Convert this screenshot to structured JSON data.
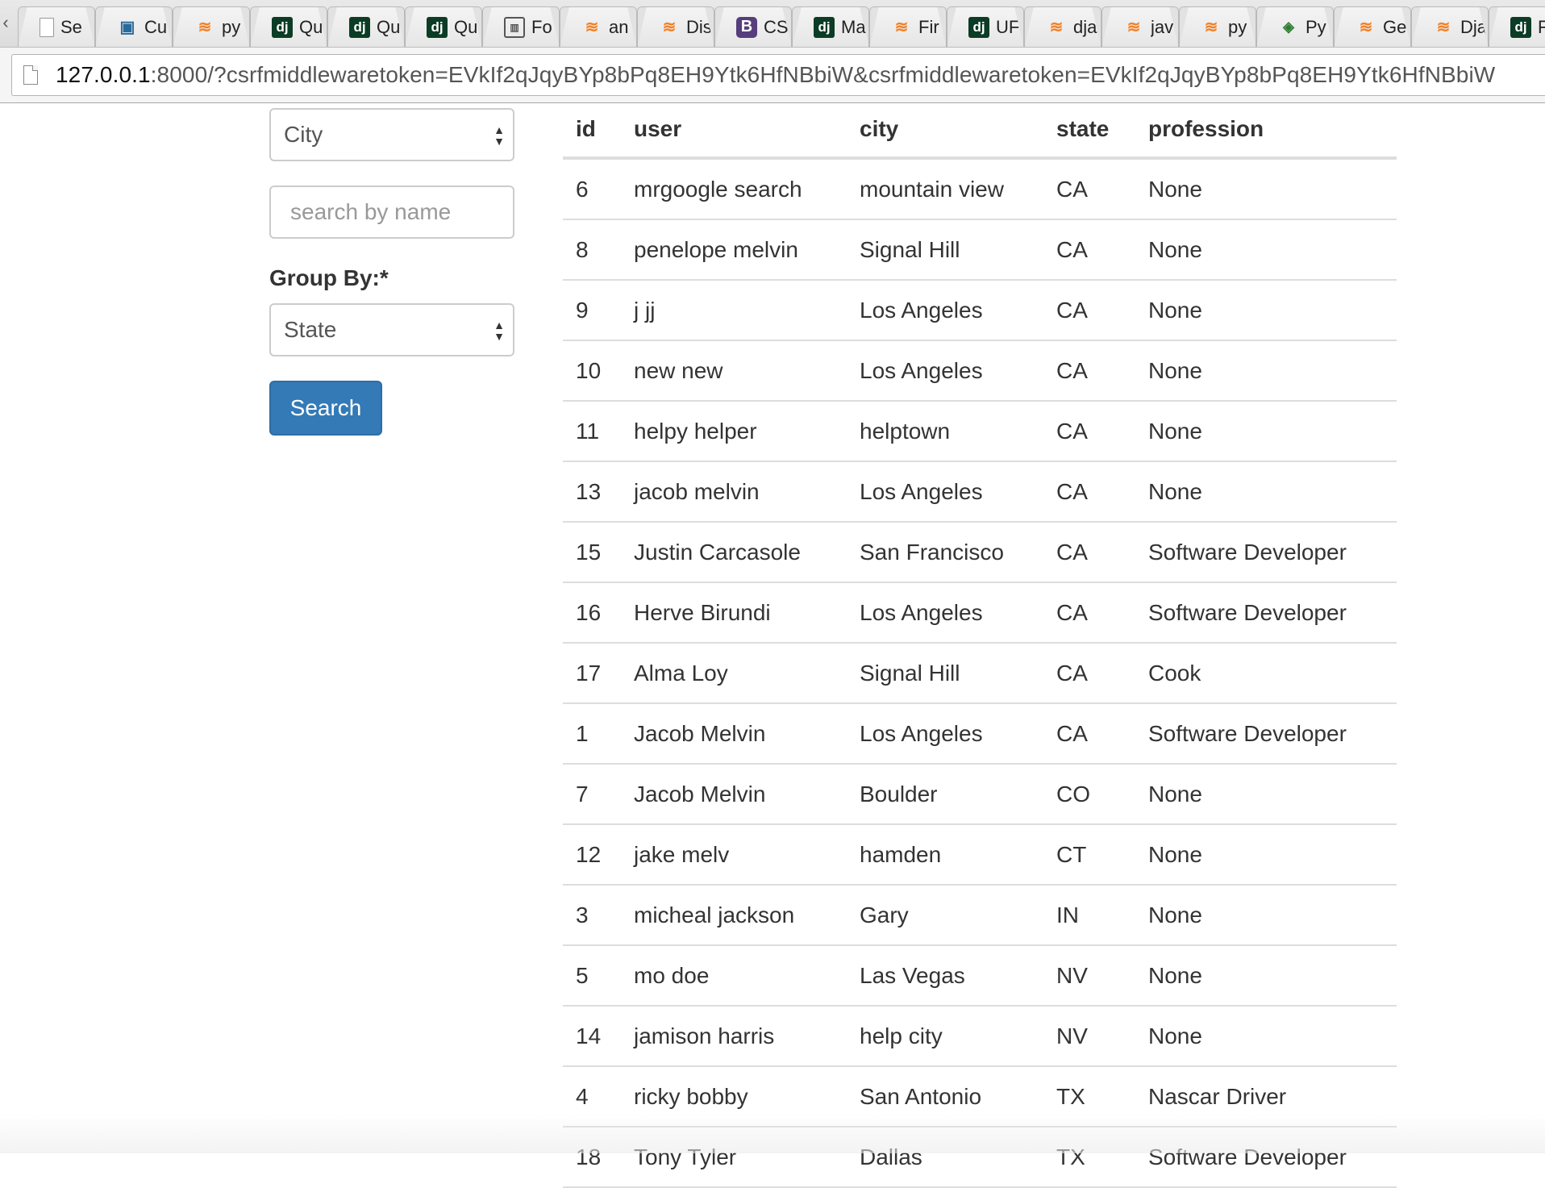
{
  "browser": {
    "tabs": [
      {
        "title": "Se",
        "icon": "blank-page-icon"
      },
      {
        "title": "Cu",
        "icon": "app-icon"
      },
      {
        "title": "py",
        "icon": "stackoverflow-icon"
      },
      {
        "title": "Qu",
        "icon": "django-icon"
      },
      {
        "title": "Qu",
        "icon": "django-icon"
      },
      {
        "title": "Qu",
        "icon": "django-icon"
      },
      {
        "title": "Fo",
        "icon": "form-icon"
      },
      {
        "title": "an",
        "icon": "stackoverflow-icon"
      },
      {
        "title": "Dis",
        "icon": "stackoverflow-icon"
      },
      {
        "title": "CS",
        "icon": "bootstrap-icon"
      },
      {
        "title": "Ma",
        "icon": "django-icon"
      },
      {
        "title": "Fir",
        "icon": "stackoverflow-icon"
      },
      {
        "title": "UF",
        "icon": "django-icon"
      },
      {
        "title": "dja",
        "icon": "stackoverflow-icon"
      },
      {
        "title": "jav",
        "icon": "stackoverflow-icon"
      },
      {
        "title": "py",
        "icon": "stackoverflow-icon"
      },
      {
        "title": "Py",
        "icon": "python-icon"
      },
      {
        "title": "Ge",
        "icon": "stackoverflow-icon"
      },
      {
        "title": "Dja",
        "icon": "stackoverflow-icon"
      },
      {
        "title": "F",
        "icon": "django-icon"
      }
    ],
    "url_host": "127.0.0.1",
    "url_rest": ":8000/?csrfmiddlewaretoken=EVkIf2qJqyBYp8bPq8EH9Ytk6HfNBbiW&csrfmiddlewaretoken=EVkIf2qJqyBYp8bPq8EH9Ytk6HfNBbiW"
  },
  "filters": {
    "filter_select_value": "City",
    "search_placeholder": "search by name",
    "search_value": "",
    "group_by_label": "Group By:*",
    "group_by_value": "State",
    "search_button_label": "Search"
  },
  "table": {
    "columns": [
      "id",
      "user",
      "city",
      "state",
      "profession"
    ],
    "rows": [
      [
        "6",
        "mrgoogle search",
        "mountain view",
        "CA",
        "None"
      ],
      [
        "8",
        "penelope melvin",
        "Signal Hill",
        "CA",
        "None"
      ],
      [
        "9",
        "j jj",
        "Los Angeles",
        "CA",
        "None"
      ],
      [
        "10",
        "new new",
        "Los Angeles",
        "CA",
        "None"
      ],
      [
        "11",
        "helpy helper",
        "helptown",
        "CA",
        "None"
      ],
      [
        "13",
        "jacob melvin",
        "Los Angeles",
        "CA",
        "None"
      ],
      [
        "15",
        "Justin Carcasole",
        "San Francisco",
        "CA",
        "Software Developer"
      ],
      [
        "16",
        "Herve Birundi",
        "Los Angeles",
        "CA",
        "Software Developer"
      ],
      [
        "17",
        "Alma Loy",
        "Signal Hill",
        "CA",
        "Cook"
      ],
      [
        "1",
        "Jacob Melvin",
        "Los Angeles",
        "CA",
        "Software Developer"
      ],
      [
        "7",
        "Jacob Melvin",
        "Boulder",
        "CO",
        "None"
      ],
      [
        "12",
        "jake melv",
        "hamden",
        "CT",
        "None"
      ],
      [
        "3",
        "micheal jackson",
        "Gary",
        "IN",
        "None"
      ],
      [
        "5",
        "mo doe",
        "Las Vegas",
        "NV",
        "None"
      ],
      [
        "14",
        "jamison harris",
        "help city",
        "NV",
        "None"
      ],
      [
        "4",
        "ricky bobby",
        "San Antonio",
        "TX",
        "Nascar Driver"
      ],
      [
        "18",
        "Tony Tyler",
        "Dallas",
        "TX",
        "Software Developer"
      ]
    ]
  }
}
